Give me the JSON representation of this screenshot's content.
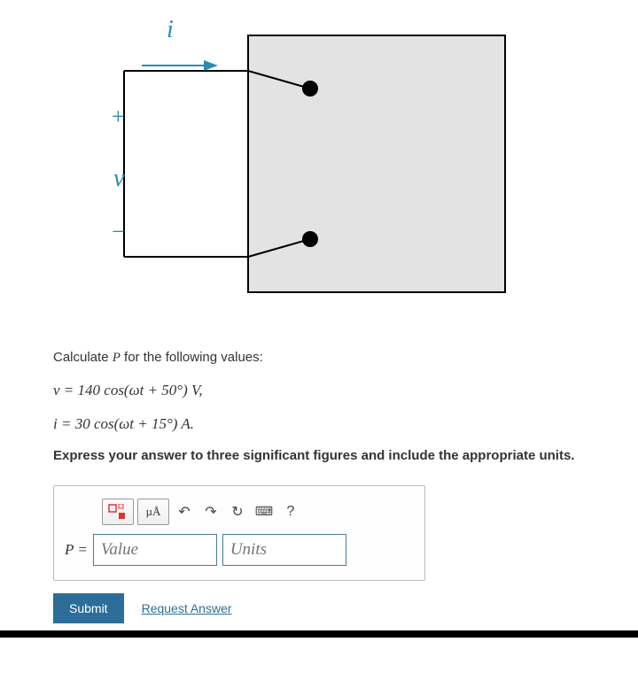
{
  "diagram": {
    "current_label": "i",
    "plus": "+",
    "voltage_label": "v",
    "minus": "−"
  },
  "problem": {
    "intro_pre": "Calculate ",
    "intro_var": "P",
    "intro_post": " for the following values:",
    "eq_v": "v = 140 cos(ωt + 50°) V,",
    "eq_i": "i = 30 cos(ωt + 15°) A.",
    "instruction": "Express your answer to three significant figures and include the appropriate units."
  },
  "toolbar": {
    "template_label": "□",
    "units_label": "µÅ",
    "undo_glyph": "↶",
    "redo_glyph": "↷",
    "reset_glyph": "↻",
    "keyboard_glyph": "⌨",
    "help_glyph": "?"
  },
  "input": {
    "lhs": "P =",
    "value_placeholder": "Value",
    "units_placeholder": "Units"
  },
  "actions": {
    "submit": "Submit",
    "request": "Request Answer"
  }
}
